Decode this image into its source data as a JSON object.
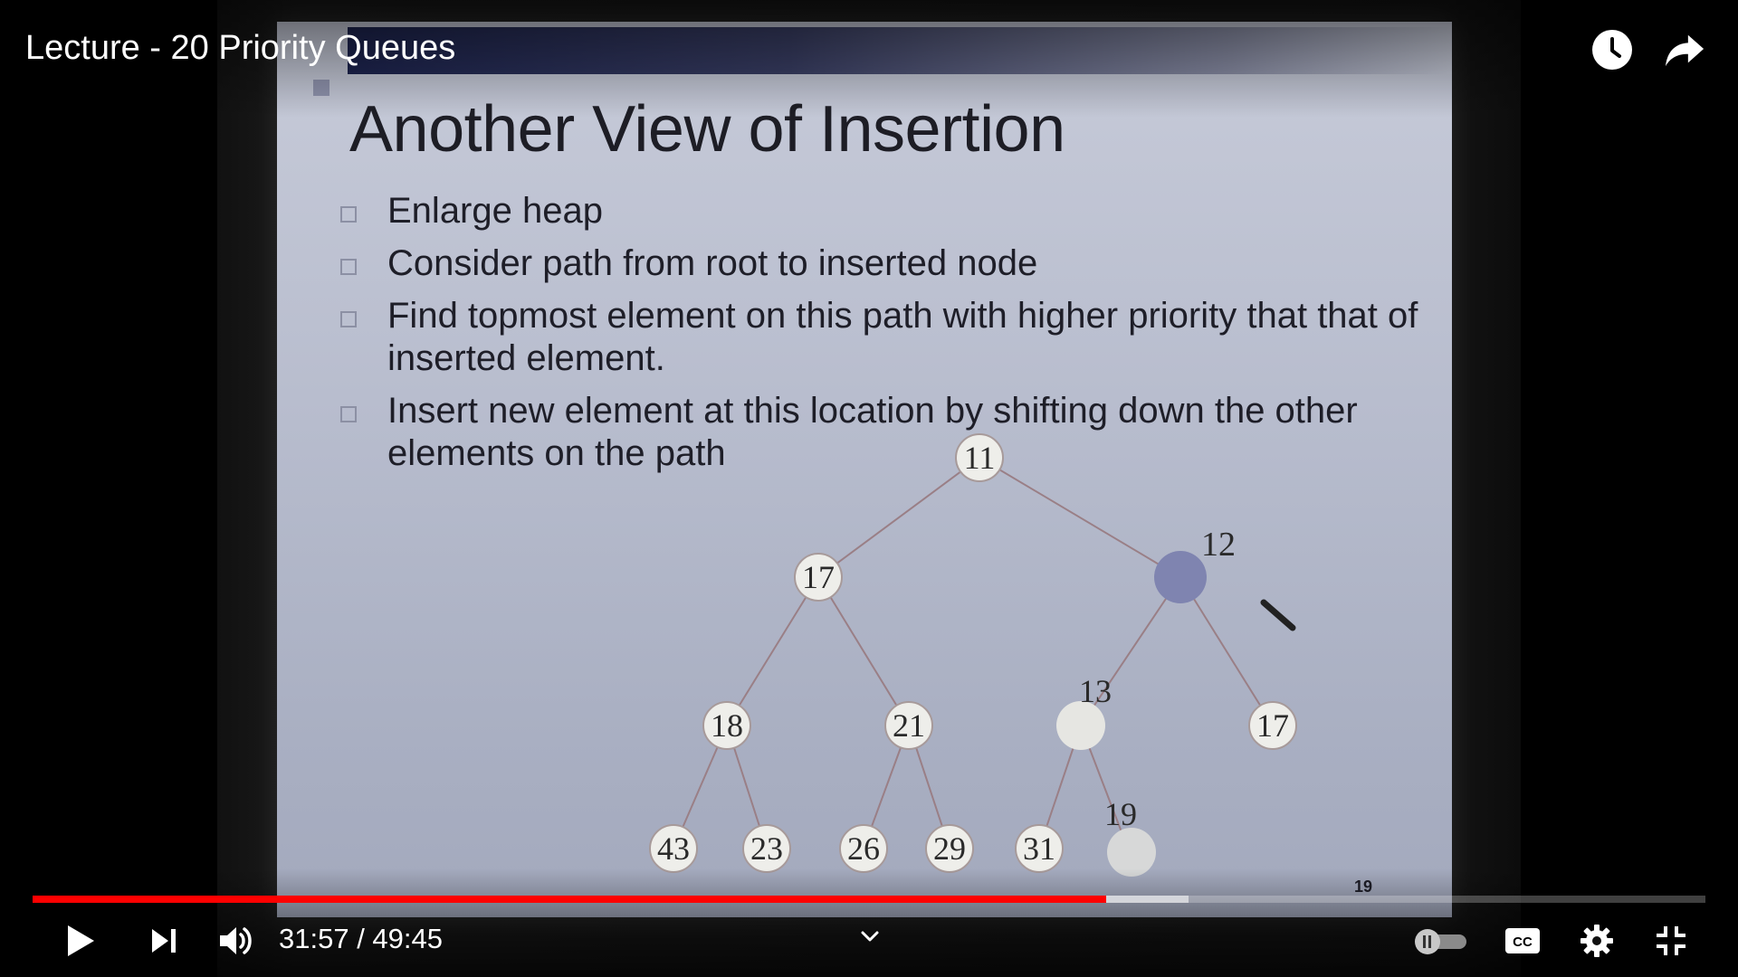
{
  "player": {
    "title": "Lecture - 20 Priority Queues",
    "time": {
      "current": "31:57",
      "separator": " / ",
      "duration": "49:45",
      "display": "31:57 / 49:45"
    },
    "progress": {
      "played_fraction": 0.642,
      "buffered_fraction": 0.691
    },
    "colors": {
      "progress_played": "#ff0000",
      "progress_buffered": "#bdbdbd",
      "icon": "#ffffff"
    },
    "icons": {
      "watch_later": "clock-icon",
      "share": "share-arrow-icon",
      "play": "play-icon",
      "next": "next-icon",
      "volume": "volume-icon",
      "chapters": "chevron-down-icon",
      "autoplay": "autoplay-toggle-icon",
      "captions": "cc-icon",
      "settings": "gear-icon",
      "fullscreen": "exit-fullscreen-icon"
    }
  },
  "slide": {
    "title": "Another View of Insertion",
    "bullets": [
      "Enlarge heap",
      "Consider path from root to inserted node",
      "Find topmost element on this path with higher priority that that of inserted element.",
      "Insert new element at this location by shifting down the other elements on the path"
    ],
    "page_number": "19",
    "heap_nodes": [
      "11",
      "17",
      "12",
      "18",
      "21",
      "13",
      "17",
      "43",
      "23",
      "26",
      "29",
      "31",
      "19"
    ]
  }
}
